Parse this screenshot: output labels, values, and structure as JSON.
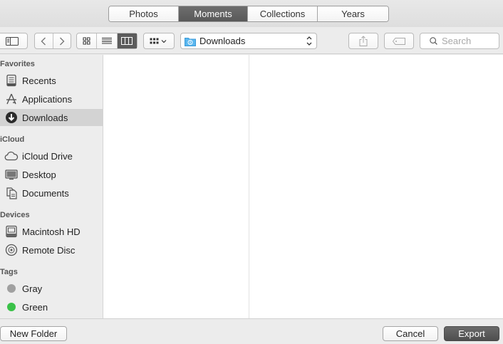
{
  "top_segments": [
    "Photos",
    "Moments",
    "Collections",
    "Years"
  ],
  "top_selected": "Moments",
  "toolbar": {
    "location": "Downloads",
    "search_placeholder": "Search"
  },
  "sidebar": {
    "favorites_title": "Favorites",
    "favorites": [
      {
        "label": "Recents",
        "icon": "recents-icon"
      },
      {
        "label": "Applications",
        "icon": "applications-icon"
      },
      {
        "label": "Downloads",
        "icon": "downloads-icon",
        "active": true
      }
    ],
    "cloud_title": "iCloud",
    "cloud": [
      {
        "label": "iCloud Drive",
        "icon": "icloud-drive-icon"
      },
      {
        "label": "Desktop",
        "icon": "desktop-icon"
      },
      {
        "label": "Documents",
        "icon": "documents-icon"
      }
    ],
    "devices_title": "Devices",
    "devices": [
      {
        "label": "Macintosh HD",
        "icon": "hard-drive-icon"
      },
      {
        "label": "Remote Disc",
        "icon": "disc-icon"
      }
    ],
    "tags_title": "Tags",
    "tags": [
      {
        "label": "Gray",
        "color": "#a0a0a0"
      },
      {
        "label": "Green",
        "color": "#3ac148"
      }
    ]
  },
  "bottom": {
    "new_folder": "New Folder",
    "cancel": "Cancel",
    "export": "Export"
  }
}
